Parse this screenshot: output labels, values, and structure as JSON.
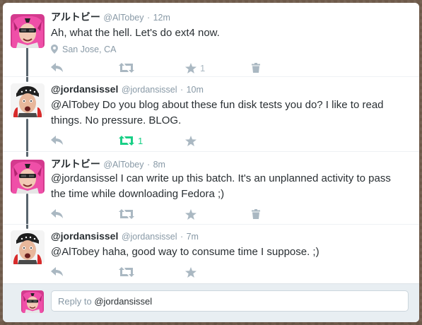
{
  "tweets": [
    {
      "name": "アルトビー",
      "handle": "@AlTobey",
      "separator": "·",
      "time": "12m",
      "text": "Ah, what the hell. Let's do ext4 now.",
      "location": "San Jose, CA",
      "like_count": "1",
      "avatar": "pink-haired-avatar"
    },
    {
      "name": "@jordansissel",
      "handle": "@jordansissel",
      "separator": "·",
      "time": "10m",
      "text": "@AlTobey Do you blog about these fun disk tests you do? I like to read things. No pressure. BLOG.",
      "retweet_count": "1",
      "avatar": "bandana-man-avatar"
    },
    {
      "name": "アルトビー",
      "handle": "@AlTobey",
      "separator": "·",
      "time": "8m",
      "text": "@jordansissel I can write up this batch. It's an unplanned activity to pass the time while downloading Fedora ;)",
      "avatar": "pink-haired-avatar"
    },
    {
      "name": "@jordansissel",
      "handle": "@jordansissel",
      "separator": "·",
      "time": "7m",
      "text": "@AlTobey haha, good way to consume time I suppose. ;)",
      "avatar": "bandana-man-avatar"
    }
  ],
  "reply": {
    "prefix": "Reply to",
    "mention": "@jordansissel"
  },
  "colors": {
    "thread_line": "#59656e",
    "retweet_active": "#19cf86",
    "action_icon": "#aab8c2",
    "reply_bg": "#e8eef2"
  }
}
